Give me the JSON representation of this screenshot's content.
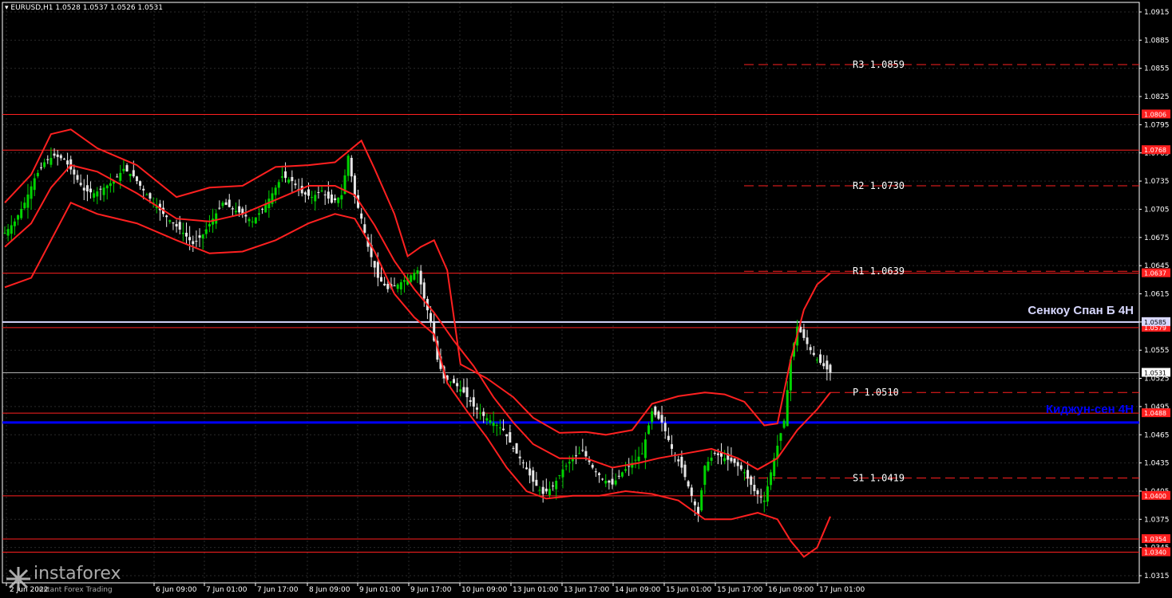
{
  "header": {
    "symbol_line": "EURUSD,H1  1.0528 1.0537 1.0526 1.0531"
  },
  "watermark": {
    "brand": "instaforex",
    "tagline": "Instant Forex Trading"
  },
  "colors": {
    "background": "#000000",
    "grid": "#2a2a2a",
    "bullish": "#00d400",
    "bearish": "#e8e8e8",
    "indicator": "#ff2020",
    "pivot_line": "#ff2020",
    "kijun": "#0000ff",
    "senkou": "#d8d8ff",
    "price_tag": "#ffffff"
  },
  "chart_data": {
    "type": "candlestick",
    "title": "",
    "xlabel": "",
    "ylabel": "",
    "ylim": [
      1.0315,
      1.0925
    ],
    "grid": true,
    "y_ticks": [
      "1.0915",
      "1.0885",
      "1.0855",
      "1.0825",
      "1.0795",
      "1.0765",
      "1.0735",
      "1.0705",
      "1.0675",
      "1.0645",
      "1.0615",
      "1.0585",
      "1.0555",
      "1.0525",
      "1.0495",
      "1.0465",
      "1.0435",
      "1.0405",
      "1.0375",
      "1.0345",
      "1.0315"
    ],
    "x_ticks": [
      "2 Jun 2022",
      "6 Jun 09:00",
      "7 Jun 01:00",
      "7 Jun 17:00",
      "8 Jun 09:00",
      "9 Jun 01:00",
      "9 Jun 17:00",
      "10 Jun 09:00",
      "13 Jun 01:00",
      "13 Jun 17:00",
      "14 Jun 09:00",
      "15 Jun 01:00",
      "15 Jun 17:00",
      "16 Jun 09:00",
      "17 Jun 01:00"
    ],
    "price_series": [
      [
        0,
        1.068
      ],
      [
        3,
        1.0692
      ],
      [
        6,
        1.0712
      ],
      [
        9,
        1.0738
      ],
      [
        12,
        1.0755
      ],
      [
        15,
        1.0762
      ],
      [
        18,
        1.0758
      ],
      [
        21,
        1.0742
      ],
      [
        24,
        1.0725
      ],
      [
        27,
        1.0722
      ],
      [
        30,
        1.0728
      ],
      [
        33,
        1.0735
      ],
      [
        36,
        1.0748
      ],
      [
        39,
        1.074
      ],
      [
        42,
        1.0725
      ],
      [
        45,
        1.0712
      ],
      [
        48,
        1.07
      ],
      [
        51,
        1.069
      ],
      [
        54,
        1.068
      ],
      [
        57,
        1.0668
      ],
      [
        60,
        1.0678
      ],
      [
        63,
        1.0695
      ],
      [
        66,
        1.0712
      ],
      [
        69,
        1.0705
      ],
      [
        72,
        1.07
      ],
      [
        75,
        1.0692
      ],
      [
        78,
        1.0705
      ],
      [
        81,
        1.0722
      ],
      [
        84,
        1.074
      ],
      [
        87,
        1.0735
      ],
      [
        90,
        1.0722
      ],
      [
        93,
        1.0718
      ],
      [
        96,
        1.0725
      ],
      [
        99,
        1.0712
      ],
      [
        102,
        1.072
      ],
      [
        104,
        1.0762
      ],
      [
        106,
        1.0718
      ],
      [
        108,
        1.0695
      ],
      [
        110,
        1.0665
      ],
      [
        113,
        1.0632
      ],
      [
        116,
        1.062
      ],
      [
        119,
        1.0625
      ],
      [
        122,
        1.0632
      ],
      [
        125,
        1.064
      ],
      [
        127,
        1.061
      ],
      [
        129,
        1.0585
      ],
      [
        131,
        1.0545
      ],
      [
        133,
        1.0525
      ],
      [
        136,
        1.052
      ],
      [
        139,
        1.051
      ],
      [
        142,
        1.0495
      ],
      [
        145,
        1.0485
      ],
      [
        148,
        1.0478
      ],
      [
        151,
        1.047
      ],
      [
        154,
        1.045
      ],
      [
        157,
        1.0435
      ],
      [
        160,
        1.0415
      ],
      [
        163,
        1.0402
      ],
      [
        166,
        1.041
      ],
      [
        169,
        1.0428
      ],
      [
        172,
        1.044
      ],
      [
        175,
        1.0448
      ],
      [
        178,
        1.043
      ],
      [
        181,
        1.0418
      ],
      [
        184,
        1.0412
      ],
      [
        187,
        1.0425
      ],
      [
        190,
        1.0435
      ],
      [
        193,
        1.0445
      ],
      [
        196,
        1.049
      ],
      [
        199,
        1.0478
      ],
      [
        202,
        1.045
      ],
      [
        205,
        1.043
      ],
      [
        208,
        1.04
      ],
      [
        210,
        1.038
      ],
      [
        212,
        1.0432
      ],
      [
        215,
        1.0445
      ],
      [
        218,
        1.044
      ],
      [
        221,
        1.0435
      ],
      [
        224,
        1.0425
      ],
      [
        227,
        1.0405
      ],
      [
        230,
        1.0395
      ],
      [
        233,
        1.044
      ],
      [
        236,
        1.048
      ],
      [
        238,
        1.0545
      ],
      [
        240,
        1.058
      ],
      [
        242,
        1.0568
      ],
      [
        244,
        1.0555
      ],
      [
        246,
        1.0545
      ],
      [
        248,
        1.0538
      ],
      [
        250,
        1.0531
      ]
    ],
    "band_upper": [
      [
        0,
        1.0712
      ],
      [
        8,
        1.0742
      ],
      [
        14,
        1.0785
      ],
      [
        20,
        1.079
      ],
      [
        28,
        1.077
      ],
      [
        40,
        1.0752
      ],
      [
        52,
        1.0718
      ],
      [
        62,
        1.0728
      ],
      [
        72,
        1.073
      ],
      [
        82,
        1.075
      ],
      [
        92,
        1.0752
      ],
      [
        100,
        1.0755
      ],
      [
        108,
        1.0778
      ],
      [
        112,
        1.0748
      ],
      [
        118,
        1.07
      ],
      [
        122,
        1.0655
      ],
      [
        126,
        1.0665
      ],
      [
        130,
        1.0672
      ],
      [
        134,
        1.064
      ],
      [
        138,
        1.054
      ],
      [
        146,
        1.0525
      ],
      [
        154,
        1.0505
      ],
      [
        160,
        1.0483
      ],
      [
        168,
        1.0467
      ],
      [
        176,
        1.0468
      ],
      [
        182,
        1.0465
      ],
      [
        190,
        1.047
      ],
      [
        196,
        1.0498
      ],
      [
        204,
        1.0506
      ],
      [
        212,
        1.051
      ],
      [
        218,
        1.0508
      ],
      [
        224,
        1.05
      ],
      [
        230,
        1.0475
      ],
      [
        234,
        1.0477
      ],
      [
        238,
        1.0545
      ],
      [
        242,
        1.0598
      ],
      [
        246,
        1.0625
      ],
      [
        250,
        1.0637
      ]
    ],
    "band_middle": [
      [
        0,
        1.0665
      ],
      [
        8,
        1.069
      ],
      [
        14,
        1.0728
      ],
      [
        20,
        1.0752
      ],
      [
        28,
        1.0745
      ],
      [
        40,
        1.0722
      ],
      [
        52,
        1.0695
      ],
      [
        62,
        1.0692
      ],
      [
        72,
        1.07
      ],
      [
        82,
        1.0715
      ],
      [
        92,
        1.073
      ],
      [
        100,
        1.073
      ],
      [
        106,
        1.072
      ],
      [
        112,
        1.0688
      ],
      [
        118,
        1.065
      ],
      [
        124,
        1.062
      ],
      [
        130,
        1.0595
      ],
      [
        136,
        1.0565
      ],
      [
        142,
        1.0538
      ],
      [
        148,
        1.0505
      ],
      [
        154,
        1.0478
      ],
      [
        160,
        1.0455
      ],
      [
        168,
        1.044
      ],
      [
        176,
        1.044
      ],
      [
        184,
        1.043
      ],
      [
        192,
        1.0435
      ],
      [
        198,
        1.044
      ],
      [
        206,
        1.0445
      ],
      [
        214,
        1.045
      ],
      [
        222,
        1.044
      ],
      [
        228,
        1.0428
      ],
      [
        234,
        1.044
      ],
      [
        240,
        1.047
      ],
      [
        246,
        1.0492
      ],
      [
        250,
        1.051
      ]
    ],
    "band_lower": [
      [
        0,
        1.0622
      ],
      [
        8,
        1.0632
      ],
      [
        14,
        1.0672
      ],
      [
        20,
        1.0712
      ],
      [
        28,
        1.07
      ],
      [
        40,
        1.069
      ],
      [
        52,
        1.0672
      ],
      [
        62,
        1.0658
      ],
      [
        72,
        1.066
      ],
      [
        82,
        1.0672
      ],
      [
        92,
        1.069
      ],
      [
        100,
        1.07
      ],
      [
        106,
        1.0695
      ],
      [
        112,
        1.066
      ],
      [
        118,
        1.0615
      ],
      [
        124,
        1.059
      ],
      [
        130,
        1.0572
      ],
      [
        134,
        1.052
      ],
      [
        140,
        1.049
      ],
      [
        146,
        1.0462
      ],
      [
        152,
        1.043
      ],
      [
        158,
        1.0405
      ],
      [
        164,
        1.0397
      ],
      [
        172,
        1.04
      ],
      [
        180,
        1.04
      ],
      [
        188,
        1.0405
      ],
      [
        196,
        1.0402
      ],
      [
        204,
        1.0395
      ],
      [
        212,
        1.0375
      ],
      [
        220,
        1.0375
      ],
      [
        228,
        1.0382
      ],
      [
        234,
        1.0375
      ],
      [
        238,
        1.0352
      ],
      [
        242,
        1.0335
      ],
      [
        246,
        1.0345
      ],
      [
        250,
        1.0378
      ]
    ],
    "horizontal_levels": [
      {
        "price": 1.0806,
        "tag": "1.0806",
        "kind": "level"
      },
      {
        "price": 1.0768,
        "tag": "1.0768",
        "kind": "level"
      },
      {
        "price": 1.0637,
        "tag": "1.0637",
        "kind": "level"
      },
      {
        "price": 1.0579,
        "tag": "1.0579",
        "kind": "level"
      },
      {
        "price": 1.0488,
        "tag": "1.0488",
        "kind": "level"
      },
      {
        "price": 1.04,
        "tag": "1.0400",
        "kind": "level"
      },
      {
        "price": 1.0354,
        "tag": "1.0354",
        "kind": "level"
      },
      {
        "price": 1.034,
        "tag": "1.0340",
        "kind": "level"
      }
    ],
    "pivots": [
      {
        "name": "R3",
        "label": "R3 1.0859",
        "price": 1.0859
      },
      {
        "name": "R2",
        "label": "R2 1.0730",
        "price": 1.073
      },
      {
        "name": "R1",
        "label": "R1 1.0639",
        "price": 1.0639
      },
      {
        "name": "P",
        "label": "P 1.0510",
        "price": 1.051
      },
      {
        "name": "S1",
        "label": "S1 1.0419",
        "price": 1.0419
      }
    ],
    "senkou_span_b": {
      "label": "Сенкоу Спан Б 4H",
      "price": 1.0585,
      "tag": "1.0585"
    },
    "kijun_sen": {
      "label": "Киджун-сен 4H",
      "price": 1.0478
    },
    "current_price": {
      "price": 1.0531,
      "tag": "1.0531"
    }
  }
}
